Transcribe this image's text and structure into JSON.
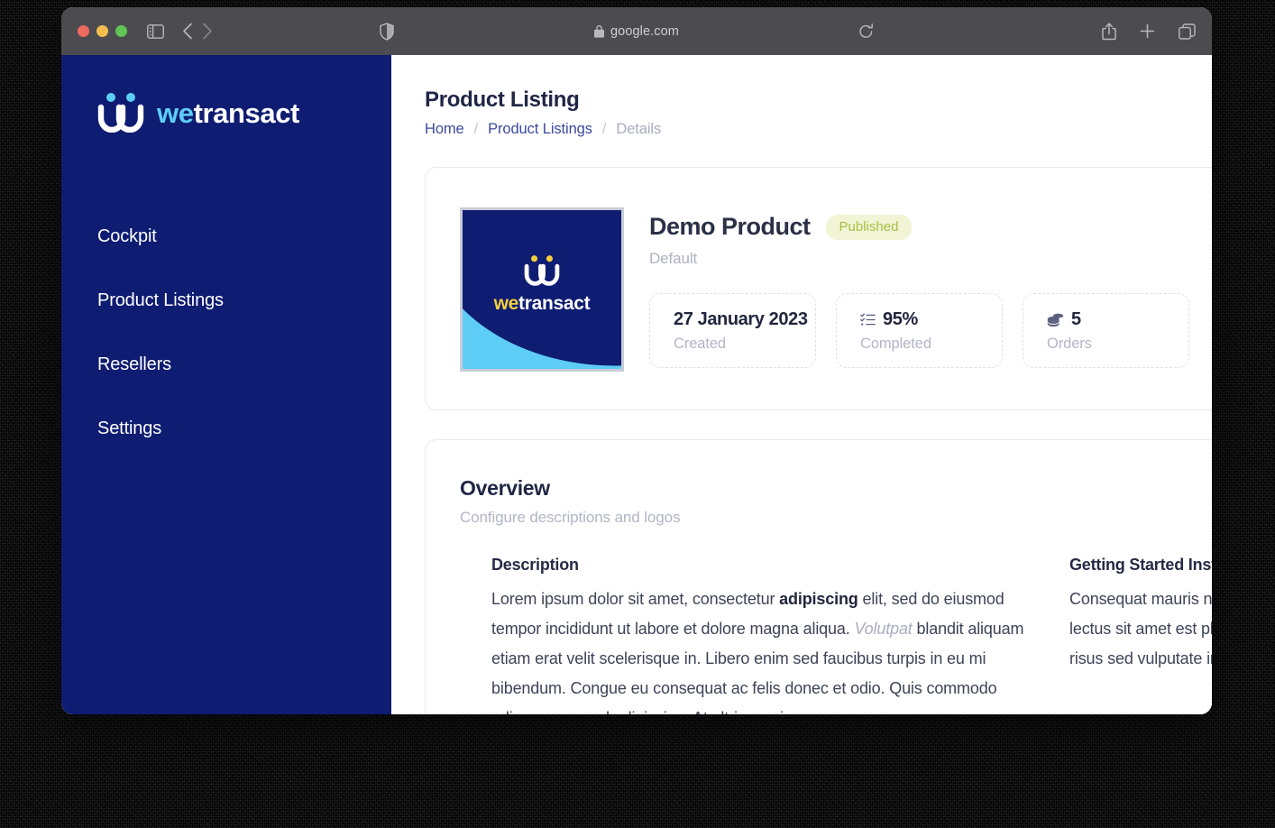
{
  "browser": {
    "url": "google.com",
    "lock_icon": "lock-icon",
    "sidebar_toggle_icon": "sidebar-toggle-icon",
    "back_icon": "chevron-left-icon",
    "forward_icon": "chevron-right-icon",
    "shield_icon": "shield-icon",
    "reload_icon": "reload-icon",
    "share_icon": "share-icon",
    "new_tab_icon": "plus-icon",
    "tabs_icon": "tab-overview-icon"
  },
  "sidebar": {
    "brand": {
      "prefix": "we",
      "suffix": "transact",
      "mark_icon": "wetransact-mark-icon"
    },
    "items": [
      {
        "label": "Cockpit"
      },
      {
        "label": "Product Listings"
      },
      {
        "label": "Resellers"
      },
      {
        "label": "Settings"
      }
    ]
  },
  "header": {
    "title": "Product Listing",
    "breadcrumb": [
      {
        "label": "Home",
        "type": "link"
      },
      {
        "label": "/",
        "type": "sep"
      },
      {
        "label": "Product Listings",
        "type": "link"
      },
      {
        "label": "/",
        "type": "sep"
      },
      {
        "label": "Details",
        "type": "current"
      }
    ]
  },
  "product": {
    "thumbnail": {
      "brand_prefix": "we",
      "brand_suffix": "transact"
    },
    "title": "Demo Product",
    "status": "Published",
    "subtitle": "Default",
    "stats": [
      {
        "value": "27 January 2023",
        "label": "Created",
        "icon": ""
      },
      {
        "value": "95%",
        "label": "Completed",
        "icon": "checklist-icon"
      },
      {
        "value": "5",
        "label": "Orders",
        "icon": "coins-icon"
      }
    ]
  },
  "overview": {
    "title": "Overview",
    "subtitle": "Configure descriptions and logos",
    "description": {
      "heading": "Description",
      "part1": "Lorem ipsum dolor sit amet, consectetur ",
      "bold": "adipiscing",
      "part2": " elit, sed do eiusmod tempor incididunt ut labore et dolore magna aliqua. ",
      "italic": "Volutpat",
      "part3": " blandit aliquam etiam erat velit scelerisque in. Libero enim sed faucibus turpis in eu mi bibendum. Congue eu consequat ac felis donec et odio. Quis commodo odio aenean sed adipiscing. At ultrices mi"
    },
    "getting_started": {
      "heading": "Getting Started Instructions",
      "body": "Consequat mauris nunc congue nisi vitae suscipit tincidunt dui ut ornare lectus sit amet est placerat maecenas. Non odio euismod lacinia at quis risus sed vulputate in"
    }
  },
  "colors": {
    "brand_navy": "#0e1c72",
    "brand_cyan": "#5ecdf5",
    "brand_yellow": "#f5cf3d",
    "badge_bg": "#f1f5d6",
    "badge_text": "#a9bd41",
    "link": "#3b4a9e"
  }
}
